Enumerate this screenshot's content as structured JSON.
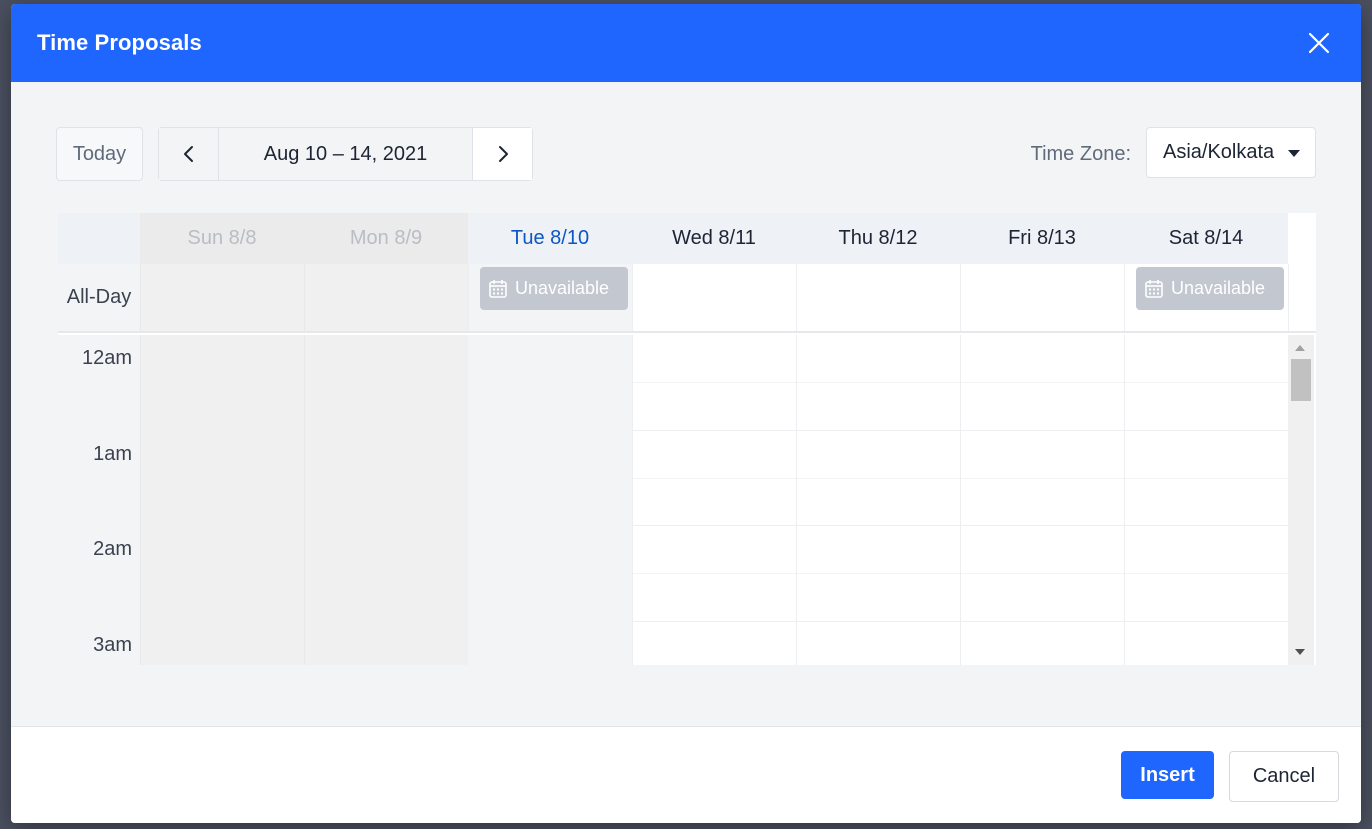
{
  "modal": {
    "title": "Time Proposals"
  },
  "toolbar": {
    "today_label": "Today",
    "date_range": "Aug 10 – 14, 2021",
    "timezone_label": "Time Zone:",
    "timezone_value": "Asia/Kolkata"
  },
  "calendar": {
    "days": [
      {
        "label": "Sun 8/8",
        "state": "past"
      },
      {
        "label": "Mon 8/9",
        "state": "past"
      },
      {
        "label": "Tue 8/10",
        "state": "today"
      },
      {
        "label": "Wed 8/11",
        "state": "normal"
      },
      {
        "label": "Thu 8/12",
        "state": "normal"
      },
      {
        "label": "Fri 8/13",
        "state": "normal"
      },
      {
        "label": "Sat 8/14",
        "state": "normal"
      }
    ],
    "allday_label": "All-Day",
    "allday_events": [
      {
        "day": "Tue 8/10",
        "label": "Unavailable",
        "icon": "calendar-icon"
      },
      {
        "day": "Sat 8/14",
        "label": "Unavailable",
        "icon": "calendar-icon"
      }
    ],
    "time_labels": [
      "12am",
      "1am",
      "2am",
      "3am"
    ]
  },
  "footer": {
    "insert_label": "Insert",
    "cancel_label": "Cancel"
  },
  "colors": {
    "primary": "#1f66ff",
    "today_text": "#0b57c5",
    "unavailable_bg": "#c2c7d0"
  }
}
